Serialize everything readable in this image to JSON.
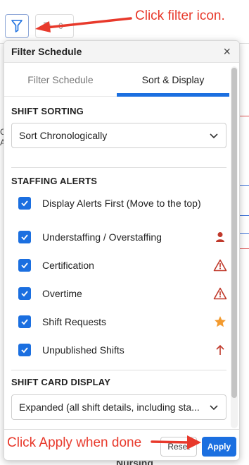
{
  "background": {
    "tag_count": "0",
    "left_frag_1": "C",
    "left_frag_2": "A",
    "bottom_text": "Nursing"
  },
  "annotations": {
    "top": "Click filter icon.",
    "bottom": "Click Apply when done"
  },
  "panel": {
    "title": "Filter Schedule",
    "close": "×",
    "tabs": [
      {
        "label": "Filter Schedule",
        "active": false
      },
      {
        "label": "Sort & Display",
        "active": true
      }
    ]
  },
  "shift_sorting": {
    "title": "SHIFT SORTING",
    "selected": "Sort Chronologically"
  },
  "staffing_alerts": {
    "title": "STAFFING ALERTS",
    "items": [
      {
        "label": "Display Alerts First (Move to the top)",
        "checked": true,
        "icon": "none"
      },
      {
        "label": "Understaffing / Overstaffing",
        "checked": true,
        "icon": "person-icon",
        "color": "#c0392b"
      },
      {
        "label": "Certification",
        "checked": true,
        "icon": "warning-icon",
        "color": "#c0392b"
      },
      {
        "label": "Overtime",
        "checked": true,
        "icon": "warning-icon",
        "color": "#c0392b"
      },
      {
        "label": "Shift Requests",
        "checked": true,
        "icon": "star-icon",
        "color": "#f39a2e"
      },
      {
        "label": "Unpublished Shifts",
        "checked": true,
        "icon": "arrow-up-icon",
        "color": "#c0392b"
      }
    ]
  },
  "shift_card_display": {
    "title": "SHIFT CARD DISPLAY",
    "selected": "Expanded (all shift details, including sta..."
  },
  "footer": {
    "reset": "Reset",
    "apply": "Apply"
  },
  "colors": {
    "accent": "#1b6fe0",
    "annotation": "#e8392b",
    "alert": "#c0392b",
    "star": "#f39a2e"
  }
}
